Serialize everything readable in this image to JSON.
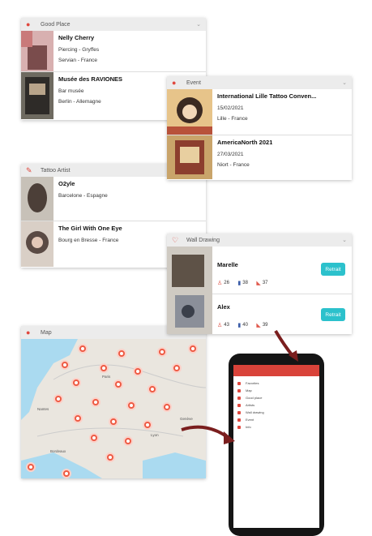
{
  "good_place": {
    "header": "Good Place",
    "items": [
      {
        "title": "Nelly Cherry",
        "line1": "Piercing - Gryffes",
        "line2": "Servian - France"
      },
      {
        "title": "Musée des RAVIONES",
        "line1": "Bar musée",
        "line2": "Berlin - Allemagne"
      }
    ]
  },
  "event": {
    "header": "Event",
    "items": [
      {
        "title": "International Lille Tattoo Conven...",
        "line1": "15/02/2021",
        "line2": "Lille - France"
      },
      {
        "title": "AmericaNorth 2021",
        "line1": "27/03/2021",
        "line2": "Niort - France"
      }
    ]
  },
  "tattoo_artist": {
    "header": "Tattoo Artist",
    "items": [
      {
        "title": "O2yle",
        "line1": "Barcelone - Espagne"
      },
      {
        "title": "The Girl With One Eye",
        "line1": "Bourg en Bresse - France"
      }
    ]
  },
  "wall_drawing": {
    "header": "Wall Drawing",
    "items": [
      {
        "name": "Marelle",
        "s1": "26",
        "s2": "38",
        "s3": "37",
        "button": "Retrait"
      },
      {
        "name": "Alex",
        "s1": "43",
        "s2": "40",
        "s3": "39",
        "button": "Retrait"
      }
    ]
  },
  "map": {
    "header": "Map",
    "labels": [
      "Paris",
      "Nantes",
      "Bordeaux",
      "Lyon",
      "Genève"
    ]
  },
  "phone": {
    "menu": [
      "Favorites",
      "Map",
      "Good place",
      "Artists",
      "Wall drawing",
      "Event",
      "Info"
    ]
  },
  "colors": {
    "accent": "#e0483e",
    "button": "#2cc1cc"
  }
}
